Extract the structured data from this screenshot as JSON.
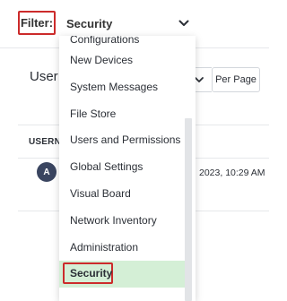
{
  "filter": {
    "label": "Filter:",
    "selected": "Security"
  },
  "users": {
    "title": "User L",
    "perpage_label": "Per Page",
    "column_username": "USERNA",
    "row": {
      "avatar_letter": "A",
      "date": "2023, 10:29 AM"
    }
  },
  "dropdown": {
    "items": [
      "Configurations",
      "New Devices",
      "System Messages",
      "File Store",
      "Users and Permissions",
      "Global Settings",
      "Visual Board",
      "Network Inventory",
      "Administration",
      "Security"
    ],
    "selected_index": 9
  },
  "colors": {
    "highlight_border": "#cc2b2b",
    "selected_bg": "#d4efd6",
    "avatar_bg": "#3a4560"
  },
  "icons": {
    "filter_select": "chevron-down-icon",
    "sort_select": "chevron-down-icon"
  }
}
